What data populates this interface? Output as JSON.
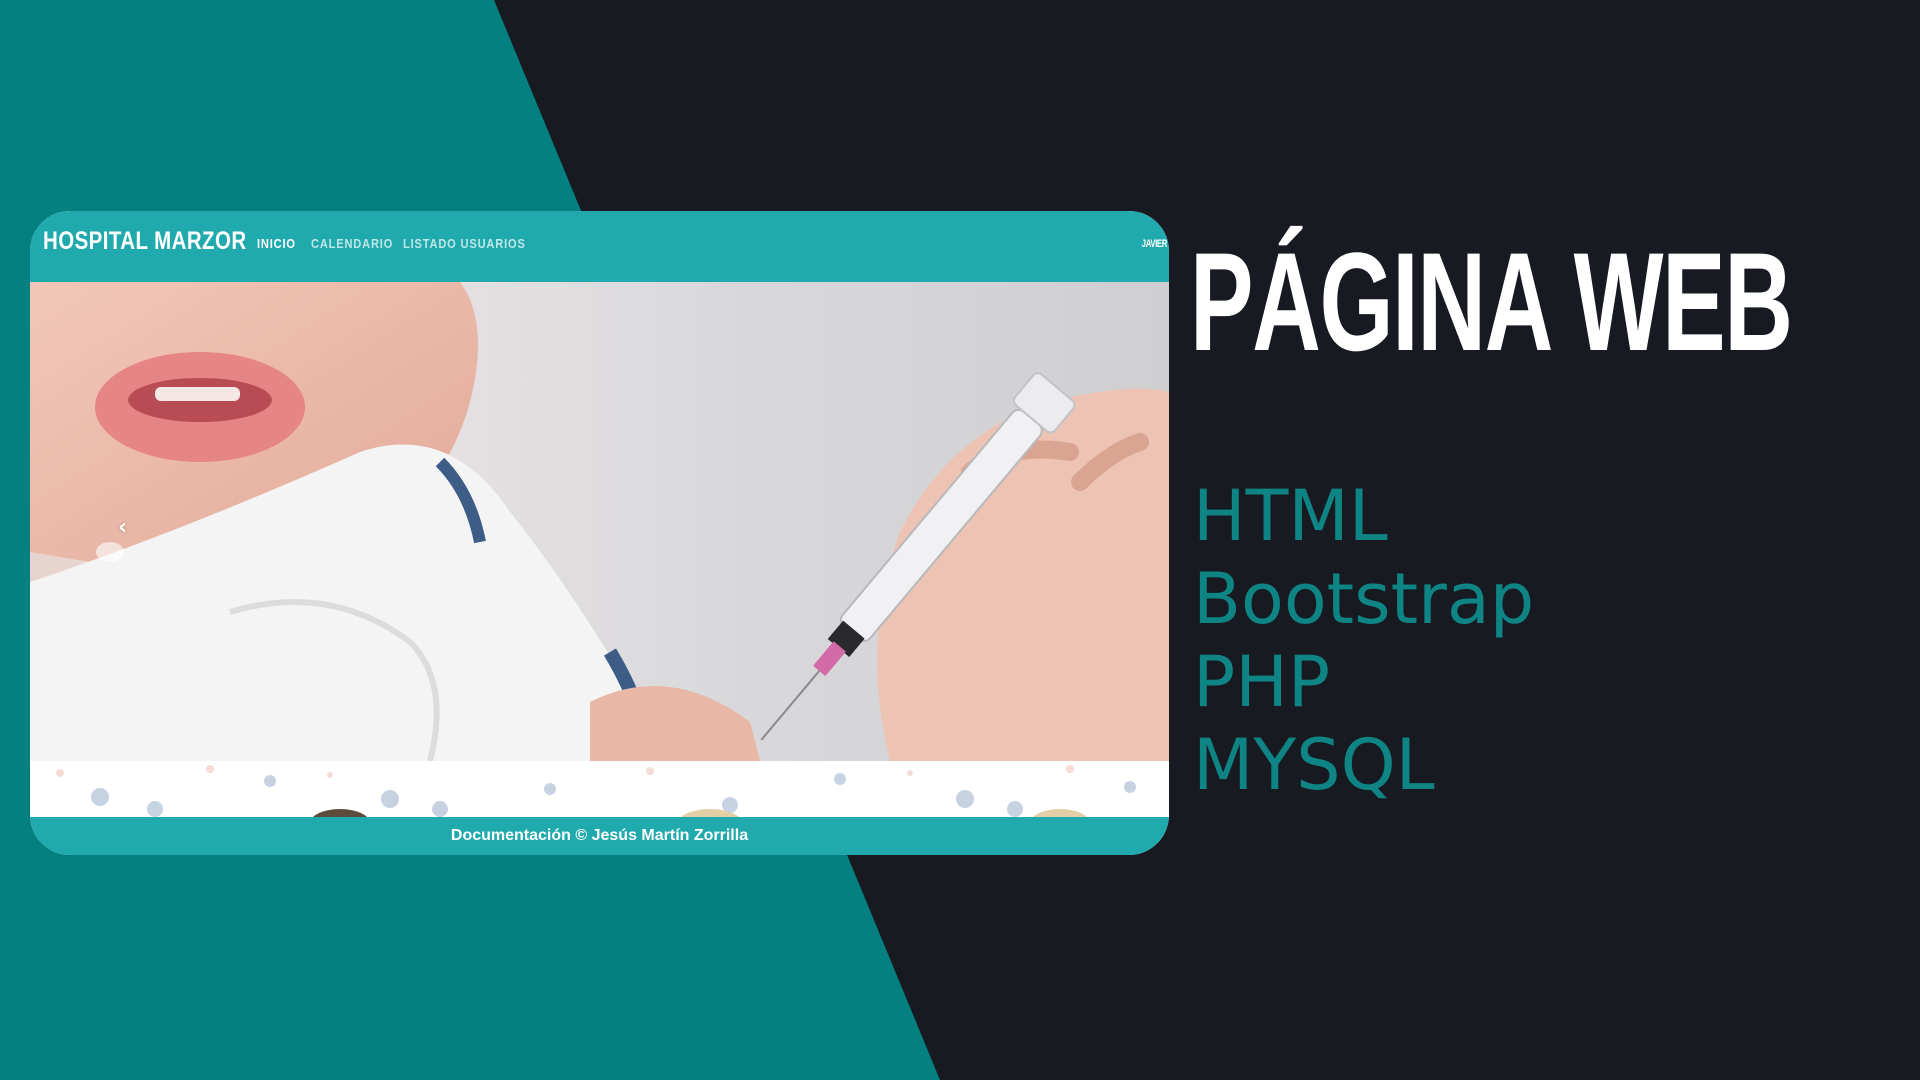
{
  "colors": {
    "background_dark": "#171a21",
    "teal_panel": "#03807f",
    "navbar": "#21aaad",
    "tech_text": "#0e8484"
  },
  "mockup": {
    "brand": "HOSPITAL MARZOR",
    "nav": [
      {
        "label": "INICIO",
        "active": true
      },
      {
        "label": "CALENDARIO",
        "active": false
      },
      {
        "label": "LISTADO USUARIOS",
        "active": false
      }
    ],
    "user": "JAVIER",
    "carousel_prev_icon": "chevron-left-icon",
    "footer": "Documentación © Jesús Martín Zorrilla"
  },
  "headline": "PÁGINA WEB",
  "technologies": [
    "HTML",
    "Bootstrap",
    "PHP",
    "MYSQL"
  ]
}
